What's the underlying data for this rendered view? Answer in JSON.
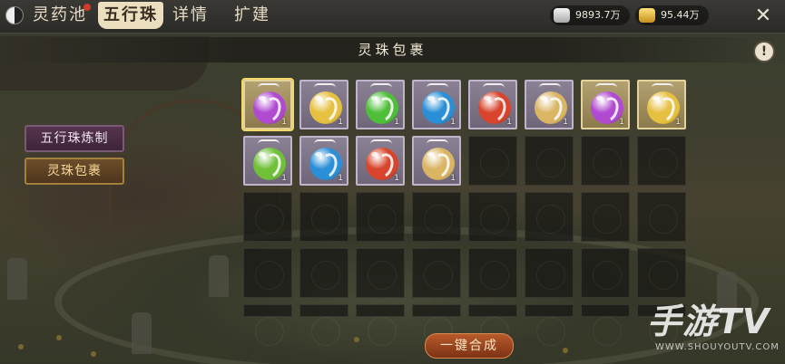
{
  "header": {
    "tabs": [
      {
        "label": "灵药池",
        "active": false,
        "has_badge": true
      },
      {
        "label": "五行珠",
        "active": true,
        "has_badge": false
      },
      {
        "label": "详情",
        "active": false,
        "has_badge": false
      },
      {
        "label": "扩建",
        "active": false,
        "has_badge": false
      }
    ],
    "resources": [
      {
        "icon": "silver-ingot-icon",
        "value": "9893.7万"
      },
      {
        "icon": "gold-ingot-icon",
        "value": "95.44万"
      }
    ]
  },
  "panel": {
    "title": "灵珠包裹"
  },
  "sidebar": {
    "items": [
      {
        "label": "五行珠炼制"
      },
      {
        "label": "灵珠包裹"
      }
    ]
  },
  "inventory": {
    "items": [
      {
        "color": "#b04ad0",
        "count": "1",
        "frame": "gold",
        "selected": true
      },
      {
        "color": "#e6c040",
        "count": "1",
        "frame": "purple"
      },
      {
        "color": "#4fbf3a",
        "count": "1",
        "frame": "purple"
      },
      {
        "color": "#2a8fd6",
        "count": "1",
        "frame": "purple"
      },
      {
        "color": "#d8442c",
        "count": "1",
        "frame": "purple"
      },
      {
        "color": "#d9b564",
        "count": "1",
        "frame": "purple"
      },
      {
        "color": "#b04ad0",
        "count": "1",
        "frame": "gold"
      },
      {
        "color": "#e6c040",
        "count": "1",
        "frame": "gold"
      },
      {
        "color": "#70c03a",
        "count": "1",
        "frame": "purple"
      },
      {
        "color": "#2a8fd6",
        "count": "1",
        "frame": "purple"
      },
      {
        "color": "#d8442c",
        "count": "1",
        "frame": "purple"
      },
      {
        "color": "#d9b564",
        "count": "1",
        "frame": "purple"
      }
    ],
    "total_slots": 40
  },
  "actions": {
    "combine_label": "一键合成"
  },
  "watermark": {
    "text": "手游TV",
    "url": "WWW.SHOUYOUTV.COM"
  }
}
